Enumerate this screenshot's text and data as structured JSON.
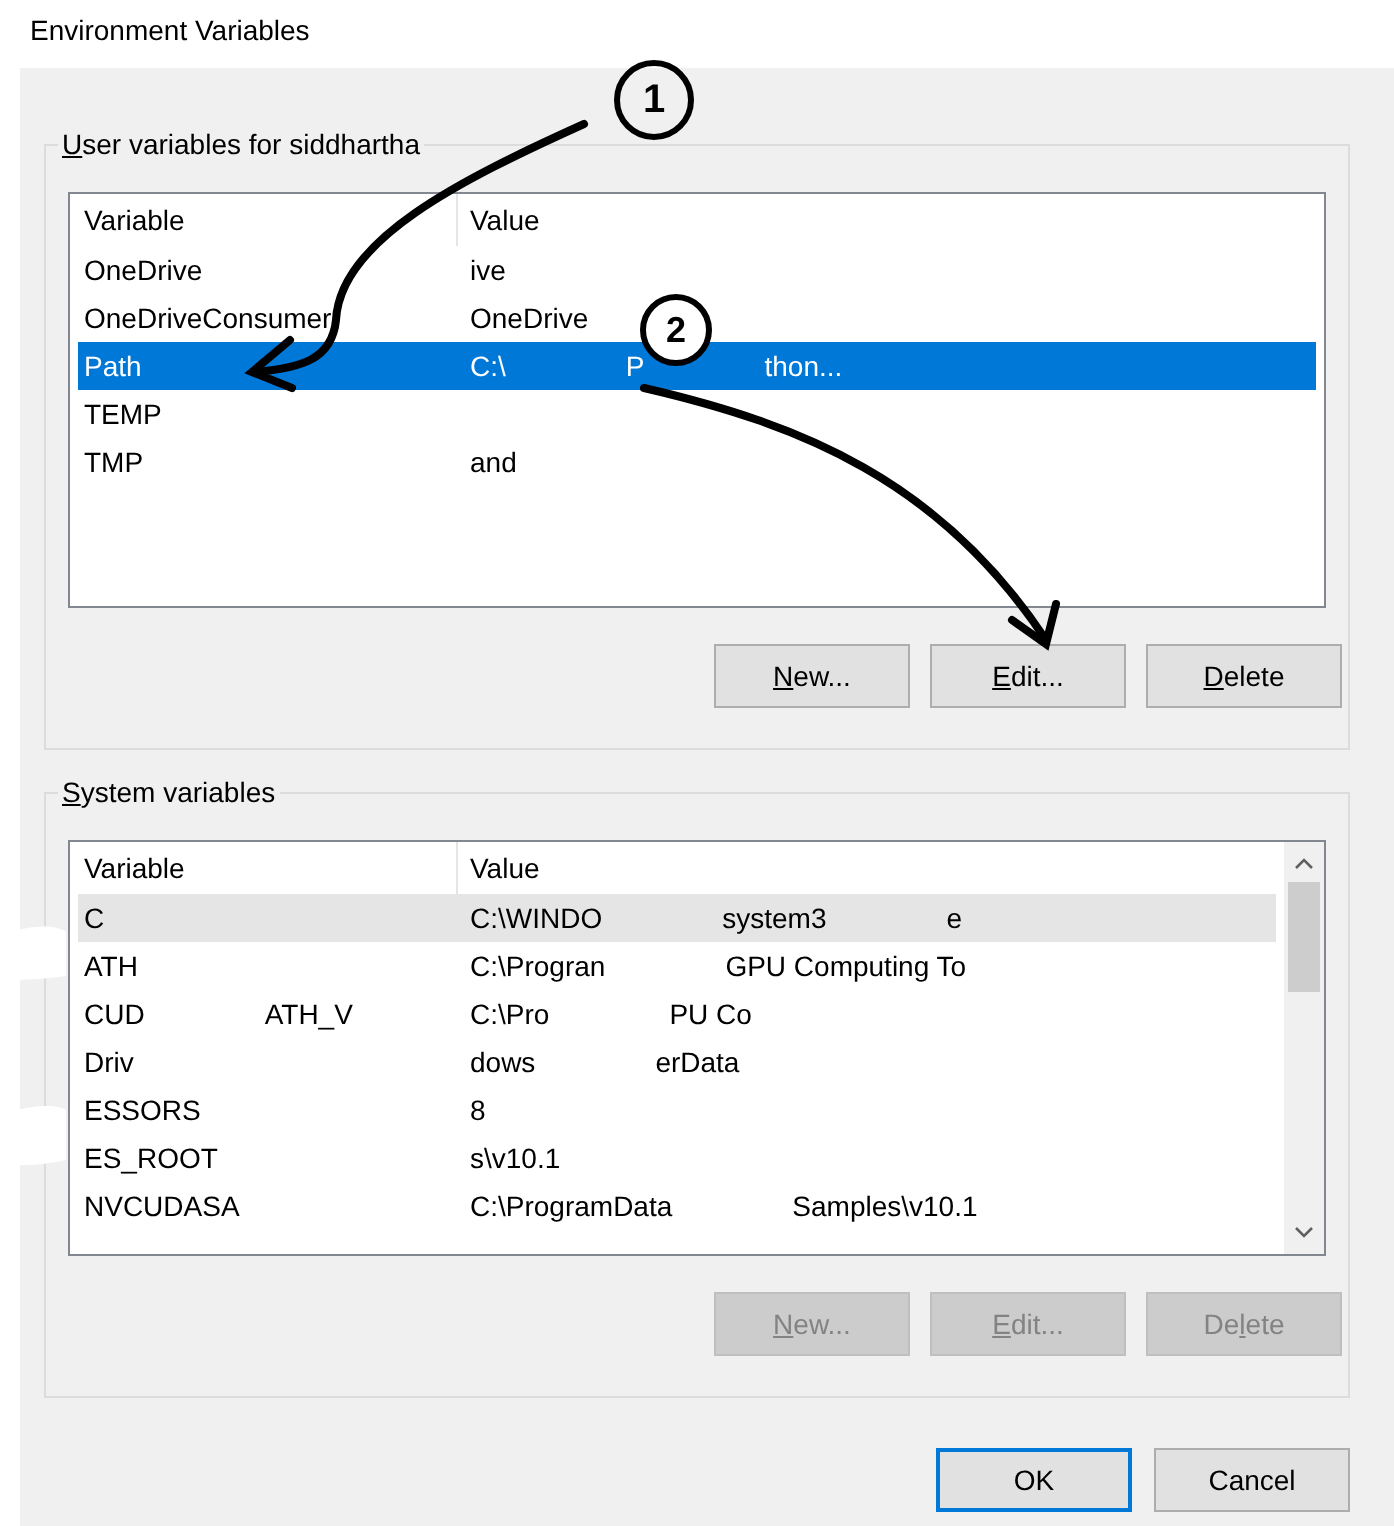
{
  "window": {
    "title": "Environment Variables"
  },
  "user_variables": {
    "title": "User variables for siddhartha",
    "columns": [
      "Variable",
      "Value"
    ],
    "rows": [
      {
        "variable": [
          "OneDrive"
        ],
        "value": [
          "ive"
        ],
        "selected": false
      },
      {
        "variable": [
          "OneDriveConsumer"
        ],
        "value": [
          "OneDrive"
        ],
        "selected": false
      },
      {
        "variable": [
          "Path"
        ],
        "value": [
          "C:\\",
          "P",
          "thon..."
        ],
        "selected": true
      },
      {
        "variable": [
          "TEMP"
        ],
        "value": [],
        "selected": false
      },
      {
        "variable": [
          "TMP"
        ],
        "value": [
          "and"
        ],
        "selected": false
      }
    ],
    "buttons": [
      {
        "label": "New...",
        "disabled": false
      },
      {
        "label": "Edit...",
        "disabled": false
      },
      {
        "label": "Delete",
        "disabled": false
      }
    ]
  },
  "system_variables": {
    "title": "System variables",
    "columns": [
      "Variable",
      "Value"
    ],
    "rows": [
      {
        "variable": [
          "C"
        ],
        "value": [
          "C:\\WINDO",
          "system3",
          "e"
        ],
        "highlighted": true
      },
      {
        "variable": [
          "ATH"
        ],
        "value": [
          "C:\\Progran",
          "GPU Computing To"
        ],
        "highlighted": false
      },
      {
        "variable": [
          "CUD",
          "ATH_V"
        ],
        "value": [
          "C:\\Pro",
          "PU Co"
        ],
        "highlighted": false
      },
      {
        "variable": [
          "Driv"
        ],
        "value": [
          "dows",
          "erData"
        ],
        "highlighted": false
      },
      {
        "variable": [
          "ESSORS"
        ],
        "value": [
          "8"
        ],
        "highlighted": false
      },
      {
        "variable": [
          "ES_ROOT"
        ],
        "value": [
          "s\\v10.1"
        ],
        "highlighted": false
      },
      {
        "variable": [
          "NVCUDASA"
        ],
        "value": [
          "C:\\ProgramData",
          "Samples\\v10.1"
        ],
        "highlighted": false
      }
    ],
    "buttons": [
      {
        "label": "New...",
        "disabled": true
      },
      {
        "label": "Edit...",
        "disabled": true
      },
      {
        "label": "Delete",
        "disabled": true
      }
    ]
  },
  "footer_buttons": [
    {
      "label": "OK",
      "default": true
    },
    {
      "label": "Cancel",
      "default": false
    }
  ],
  "annotations": [
    {
      "label": "1"
    },
    {
      "label": "2"
    }
  ]
}
